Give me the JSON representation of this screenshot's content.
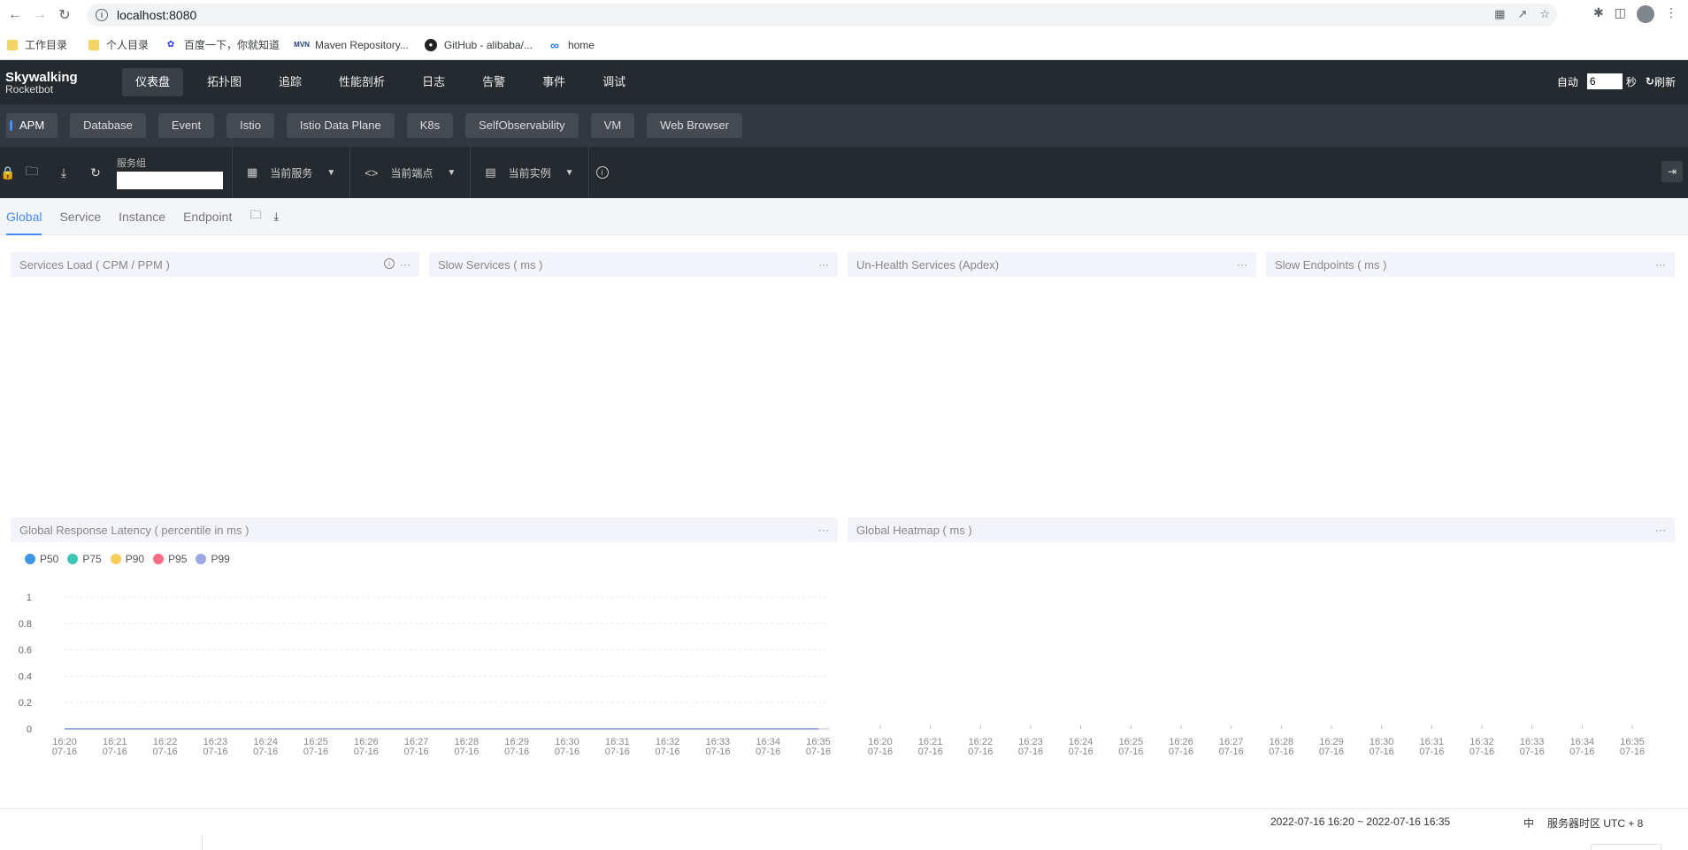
{
  "browser": {
    "url": "localhost:8080",
    "bookmarks": [
      {
        "label": "工作目录",
        "icon": "folder-icon"
      },
      {
        "label": "个人目录",
        "icon": "folder-icon"
      },
      {
        "label": "百度一下，你就知道",
        "icon": "baidu-icon"
      },
      {
        "label": "Maven Repository...",
        "icon": "maven-icon"
      },
      {
        "label": "GitHub - alibaba/...",
        "icon": "github-icon"
      },
      {
        "label": "home",
        "icon": "infinity-icon"
      }
    ]
  },
  "header": {
    "logo_line1": "Skywalking",
    "logo_line2": "Rocketbot",
    "nav": [
      "仪表盘",
      "拓扑图",
      "追踪",
      "性能剖析",
      "日志",
      "告警",
      "事件",
      "调试"
    ],
    "auto_label": "自动",
    "interval_value": "6",
    "seconds_label": "秒",
    "refresh_label": "刷新"
  },
  "layer_tabs": [
    "APM",
    "Database",
    "Event",
    "Istio",
    "Istio Data Plane",
    "K8s",
    "SelfObservability",
    "VM",
    "Web Browser"
  ],
  "toolbar": {
    "service_group_label": "服务组",
    "current_service": "当前服务",
    "current_endpoint": "当前端点",
    "current_instance": "当前实例"
  },
  "sub_tabs": [
    "Global",
    "Service",
    "Instance",
    "Endpoint"
  ],
  "panels": {
    "services_load": "Services Load ( CPM / PPM )",
    "slow_services": "Slow Services ( ms )",
    "unhealth_services": "Un-Health Services (Apdex)",
    "slow_endpoints": "Slow Endpoints ( ms )",
    "latency": "Global Response Latency ( percentile in ms )",
    "heatmap": "Global Heatmap ( ms )"
  },
  "chart_data": [
    {
      "type": "line",
      "title": "Global Response Latency ( percentile in ms )",
      "categories": [
        "16:20\n07-16",
        "16:21\n07-16",
        "16:22\n07-16",
        "16:23\n07-16",
        "16:24\n07-16",
        "16:25\n07-16",
        "16:26\n07-16",
        "16:27\n07-16",
        "16:28\n07-16",
        "16:29\n07-16",
        "16:30\n07-16",
        "16:31\n07-16",
        "16:32\n07-16",
        "16:33\n07-16",
        "16:34\n07-16",
        "16:35\n07-16"
      ],
      "series": [
        {
          "name": "P50",
          "color": "#3f96e3",
          "values": [
            0,
            0,
            0,
            0,
            0,
            0,
            0,
            0,
            0,
            0,
            0,
            0,
            0,
            0,
            0,
            0
          ]
        },
        {
          "name": "P75",
          "color": "#40c4b8",
          "values": [
            0,
            0,
            0,
            0,
            0,
            0,
            0,
            0,
            0,
            0,
            0,
            0,
            0,
            0,
            0,
            0
          ]
        },
        {
          "name": "P90",
          "color": "#f8c95b",
          "values": [
            0,
            0,
            0,
            0,
            0,
            0,
            0,
            0,
            0,
            0,
            0,
            0,
            0,
            0,
            0,
            0
          ]
        },
        {
          "name": "P95",
          "color": "#fb6a86",
          "values": [
            0,
            0,
            0,
            0,
            0,
            0,
            0,
            0,
            0,
            0,
            0,
            0,
            0,
            0,
            0,
            0
          ]
        },
        {
          "name": "P99",
          "color": "#9ea7e6",
          "values": [
            0,
            0,
            0,
            0,
            0,
            0,
            0,
            0,
            0,
            0,
            0,
            0,
            0,
            0,
            0,
            0
          ]
        }
      ],
      "yticks": [
        0,
        0.2,
        0.4,
        0.6,
        0.8,
        1
      ],
      "ylim": [
        0,
        1
      ],
      "grid": true,
      "legend": "top-left"
    },
    {
      "type": "heatmap",
      "title": "Global Heatmap ( ms )",
      "categories": [
        "16:20\n07-16",
        "16:21\n07-16",
        "16:22\n07-16",
        "16:23\n07-16",
        "16:24\n07-16",
        "16:25\n07-16",
        "16:26\n07-16",
        "16:27\n07-16",
        "16:28\n07-16",
        "16:29\n07-16",
        "16:30\n07-16",
        "16:31\n07-16",
        "16:32\n07-16",
        "16:33\n07-16",
        "16:34\n07-16",
        "16:35\n07-16"
      ],
      "values": []
    }
  ],
  "footer": {
    "time_range": "2022-07-16 16:20 ~ 2022-07-16 16:35",
    "lang": "中",
    "timezone": "服务器时区 UTC + 8"
  }
}
